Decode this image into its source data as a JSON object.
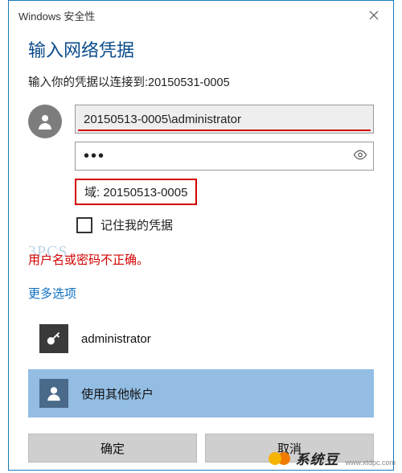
{
  "titlebar": {
    "title": "Windows 安全性"
  },
  "heading": "输入网络凭据",
  "subtext": "输入你的凭据以连接到:20150531-0005",
  "credentials": {
    "username": "20150513-0005\\administrator",
    "password_masked": "●●●",
    "domain_label": "域: 20150513-0005",
    "remember_label": "记住我的凭据"
  },
  "error_text": "用户名或密码不正确。",
  "more_options": "更多选项",
  "accounts": {
    "saved_label": "administrator",
    "other_label": "使用其他帐户"
  },
  "buttons": {
    "ok": "确定",
    "cancel": "取消"
  },
  "brand": {
    "name": "系统豆",
    "url": "www.xtdpc.com"
  },
  "watermark": "3PCS"
}
